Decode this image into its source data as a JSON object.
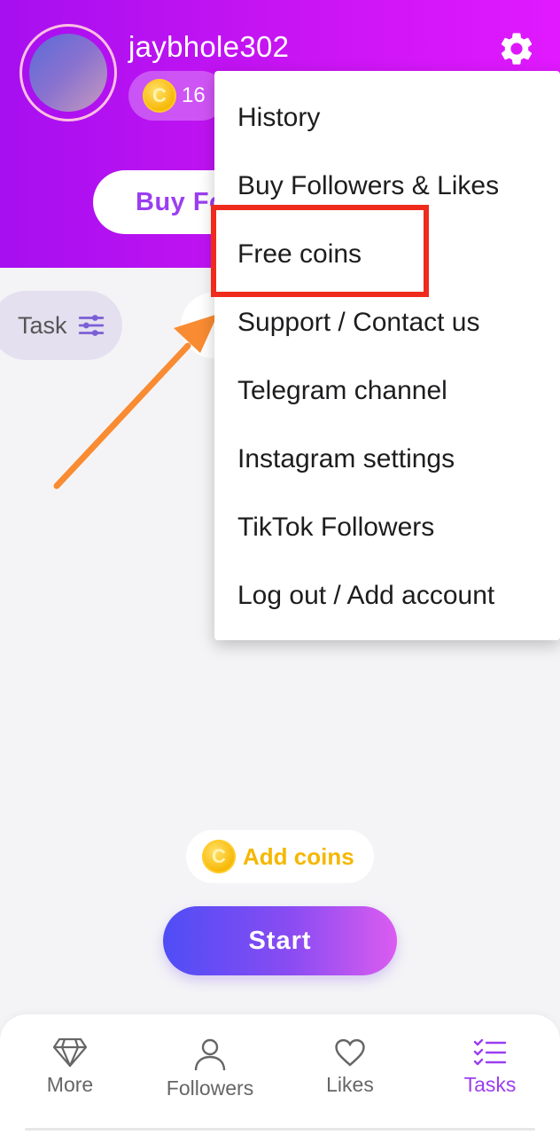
{
  "header": {
    "username": "jaybhole302",
    "coin_balance": "16",
    "coin_symbol": "C",
    "buy_button_label": "Buy Fo"
  },
  "task_chip": {
    "label": "Task"
  },
  "menu": {
    "items": [
      "History",
      "Buy Followers & Likes",
      "Free coins",
      "Support / Contact us",
      "Telegram channel",
      "Instagram settings",
      "TikTok Followers",
      "Log out / Add account"
    ]
  },
  "actions": {
    "add_coins_label": "Add coins",
    "start_label": "Start"
  },
  "nav": {
    "items": [
      {
        "label": "More",
        "icon": "diamond-icon"
      },
      {
        "label": "Followers",
        "icon": "person-icon"
      },
      {
        "label": "Likes",
        "icon": "heart-icon"
      },
      {
        "label": "Tasks",
        "icon": "checklist-icon"
      }
    ],
    "active": "Tasks"
  },
  "colors": {
    "accent": "#9b3ef0",
    "header_gradient_start": "#a60ff0",
    "header_gradient_end": "#e119ff",
    "highlight": "#ef2b1d",
    "arrow": "#f98b32",
    "coin": "#f7b500"
  }
}
